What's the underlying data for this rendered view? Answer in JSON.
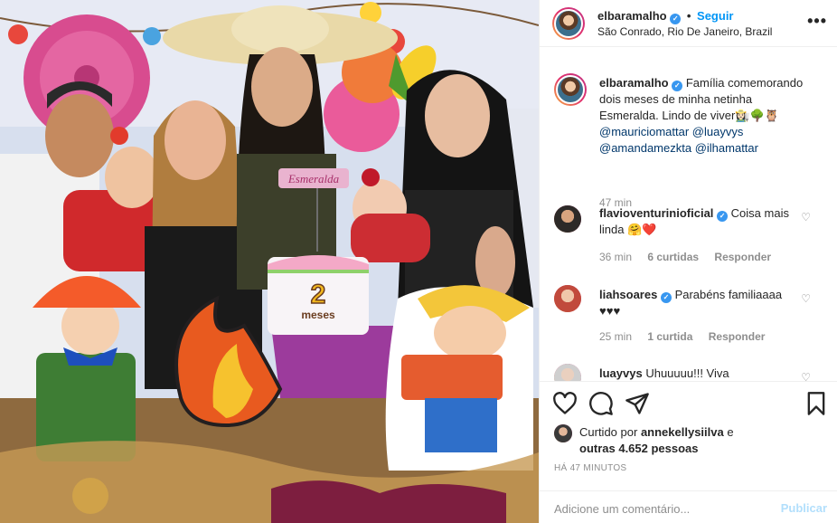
{
  "post": {
    "image_alt": "Foto de família comemorando com bolo de festa junina",
    "cake_topper": "Esmeralda",
    "cake_text_number": "2",
    "cake_text_word": "meses"
  },
  "header": {
    "username": "elbaramalho",
    "follow_label": "Seguir",
    "separator": "•",
    "location": "São Conrado, Rio De Janeiro, Brazil",
    "more_label": "•••"
  },
  "caption": {
    "username": "elbaramalho",
    "text": "Família comemorando dois meses de minha netinha Esmeralda. Lindo de viver",
    "emojis": "👩🏻‍🌾🌳🦉",
    "mentions": [
      "@mauriciomattar",
      "@luayvys",
      "@amandamezkta",
      "@ilhamattar"
    ],
    "time": "47 min"
  },
  "comments": [
    {
      "username": "flavioventurinioficial",
      "text": "Coisa mais linda",
      "emojis": "🤗❤️",
      "time": "36 min",
      "likes": "6 curtidas",
      "reply": "Responder"
    },
    {
      "username": "liahsoares",
      "text": "Parabéns familiaaaa",
      "emojis": "♥♥♥",
      "time": "25 min",
      "likes": "1 curtida",
      "reply": "Responder"
    },
    {
      "username": "luayvys",
      "text": "Uhuuuuu!!! Viva"
    }
  ],
  "likes_line": {
    "prefix": "Curtido por",
    "user": "annekellysiilva",
    "conj": "e",
    "others": "outras 4.652 pessoas"
  },
  "posted_ago": "HÁ 47 MINUTOS",
  "comment_box": {
    "placeholder": "Adicione um comentário...",
    "publish_label": "Publicar"
  },
  "colors": {
    "verified": "#3897f0",
    "follow": "#0095f6",
    "mention": "#00376b",
    "publish_disabled": "#b2dffc",
    "heart": "#ed4956"
  },
  "icons": [
    "heart-icon",
    "comment-icon",
    "share-icon",
    "bookmark-icon",
    "verified-icon",
    "like-comment-icon"
  ]
}
